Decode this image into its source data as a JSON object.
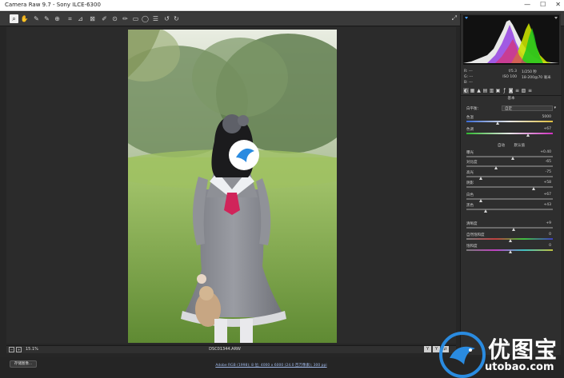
{
  "window": {
    "title": "Camera Raw 9.7  -  Sony ILCE-6300",
    "controls": [
      "—",
      "☐",
      "✕"
    ]
  },
  "toolbar": {
    "tools": [
      "zoom-tool",
      "hand-tool",
      "white-balance-tool",
      "color-sampler-tool",
      "targeted-adjustment-tool",
      "crop-tool",
      "straighten-tool",
      "spot-removal-tool",
      "red-eye-tool",
      "adjustment-brush-tool",
      "graduated-filter-tool",
      "radial-filter-tool",
      "preferences-tool",
      "rotate-left-tool",
      "rotate-right-tool"
    ]
  },
  "panel": {
    "info": {
      "rows": [
        {
          "k": "R:  ---",
          "v": "f/5.3",
          "u": "1/250 秒"
        },
        {
          "k": "G:  ---",
          "v": "ISO 100",
          "u": "18-200@70 毫米"
        },
        {
          "k": "B:  ---",
          "v": "",
          "u": ""
        }
      ]
    },
    "section_title": "基本",
    "white_balance": {
      "label": "白平衡：",
      "value": "自定"
    },
    "auto_link": "自动",
    "default_link": "默认值",
    "sliders": [
      {
        "label": "色温",
        "value": "5000"
      },
      {
        "label": "色调",
        "value": "+67"
      },
      {
        "label": "曝光",
        "value": "+0.40"
      },
      {
        "label": "对比度",
        "value": "-65"
      },
      {
        "label": "高光",
        "value": "-75"
      },
      {
        "label": "阴影",
        "value": "+58"
      },
      {
        "label": "白色",
        "value": "+67"
      },
      {
        "label": "黑色",
        "value": "+43"
      },
      {
        "label": "清晰度",
        "value": "+9"
      },
      {
        "label": "自然饱和度",
        "value": "0"
      },
      {
        "label": "饱和度",
        "value": "0"
      }
    ],
    "slider_levels": [
      0.35,
      0.71,
      0.53,
      0.33,
      0.15,
      0.77,
      0.15,
      0.21,
      0.54,
      0.5,
      0.5
    ]
  },
  "status": {
    "zoom": "15.1%",
    "filename": "DSC01344.ARW",
    "view_buttons": [
      "Y",
      "Y",
      "⇄"
    ]
  },
  "bottom": {
    "save_label": "存储图像...",
    "workflow": "Adobe RGB (1998); 8 位; 4000 x 6000 (24.0 百万像素); 300 ppi"
  },
  "watermark": {
    "cn": "优图宝",
    "en": "utobao.com"
  },
  "colors": {
    "bg": "#262626",
    "panel": "#2e2e2e",
    "link": "#9fb8e8"
  }
}
